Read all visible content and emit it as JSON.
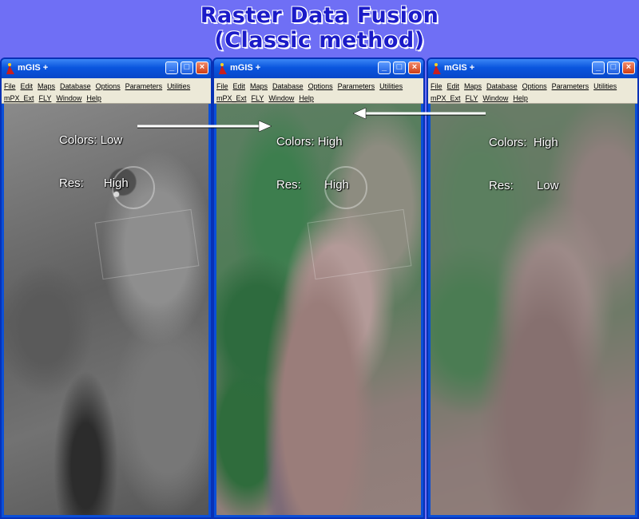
{
  "page_title": {
    "line1": "Raster Data Fusion",
    "line2": "(Classic method)"
  },
  "windows": [
    {
      "title": "mGIS +",
      "menu_row1": [
        "File",
        "Edit",
        "Maps",
        "Database",
        "Options",
        "Parameters",
        "Utilities"
      ],
      "menu_row2": [
        "mPX_Ext",
        "FLY",
        "Window",
        "Help"
      ],
      "annotation": {
        "colors_label": "Colors:",
        "colors_value": "Low",
        "res_label": "Res:",
        "res_value": "High"
      }
    },
    {
      "title": "mGIS +",
      "menu_row1": [
        "File",
        "Edit",
        "Maps",
        "Database",
        "Options",
        "Parameters",
        "Utilities"
      ],
      "menu_row2": [
        "mPX_Ext",
        "FLY",
        "Window",
        "Help"
      ],
      "annotation": {
        "colors_label": "Colors:",
        "colors_value": "High",
        "res_label": "Res:",
        "res_value": "High"
      }
    },
    {
      "title": "mGIS +",
      "menu_row1": [
        "File",
        "Edit",
        "Maps",
        "Database",
        "Options",
        "Parameters",
        "Utilities"
      ],
      "menu_row2": [
        "mPX_Ext",
        "FLY",
        "Window",
        "Help"
      ],
      "annotation": {
        "colors_label": "Colors:",
        "colors_value": "High",
        "res_label": "Res:",
        "res_value": "Low"
      }
    }
  ],
  "icons": {
    "app": "mgis-app-icon",
    "minimize": "minimize-icon",
    "maximize": "maximize-icon",
    "close": "close-icon"
  },
  "colors": {
    "background": "#6f6ff5",
    "title_text": "#1b1bc8",
    "window_frame": "#0a4fd8",
    "menubar": "#ece9d8"
  }
}
